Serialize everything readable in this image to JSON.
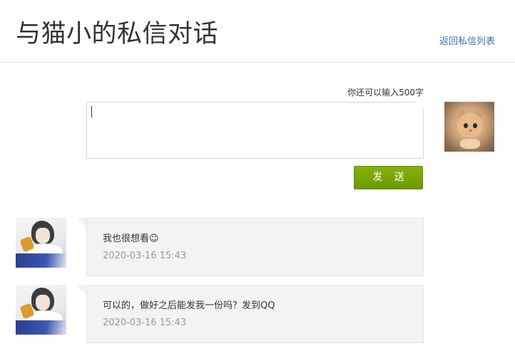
{
  "header": {
    "title": "与猫小的私信对话",
    "back_link": "返回私信列表"
  },
  "composer": {
    "char_count": "你还可以输入500字",
    "value": "",
    "send_label": "发 送"
  },
  "colors": {
    "send_button": "#7aa80a",
    "link": "#3f72af",
    "bubble_bg": "#f3f3f3",
    "timestamp": "#999999"
  },
  "messages": [
    {
      "text": "我也很想看☺",
      "time": "2020-03-16 15:43"
    },
    {
      "text": "可以的，做好之后能发我一份吗？发到QQ",
      "time": "2020-03-16 15:43"
    }
  ]
}
